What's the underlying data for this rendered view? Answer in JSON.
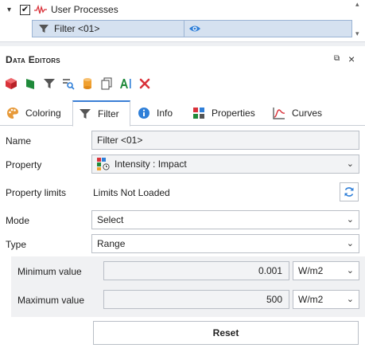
{
  "tree": {
    "process_label": "User Processes",
    "checked_mark": "✔",
    "filter_item_label": "Filter <01>",
    "expander": "▾",
    "scroll_up": "▴",
    "scroll_down": "▾"
  },
  "panel": {
    "title": "Data Editors",
    "float_glyph": "⧉",
    "close_glyph": "×"
  },
  "toolbar": {
    "icons": [
      "cube-red-icon",
      "flag-green-icon",
      "filter-icon",
      "query-icon",
      "cylinder-icon",
      "copy-icon",
      "text-label-icon",
      "delete-icon"
    ]
  },
  "tabs": [
    {
      "label": "Coloring",
      "icon": "palette-icon"
    },
    {
      "label": "Filter",
      "icon": "filter-icon",
      "active": true
    },
    {
      "label": "Info",
      "icon": "info-icon"
    },
    {
      "label": "Properties",
      "icon": "properties-icon"
    },
    {
      "label": "Curves",
      "icon": "curves-icon"
    }
  ],
  "form": {
    "name_label": "Name",
    "name_value": "Filter <01>",
    "property_label": "Property",
    "property_value": "Intensity : Impact",
    "limits_label": "Property limits",
    "limits_value": "Limits Not Loaded",
    "mode_label": "Mode",
    "mode_value": "Select",
    "type_label": "Type",
    "type_value": "Range",
    "min_label": "Minimum value",
    "min_value": "0.001",
    "min_unit": "W/m2",
    "max_label": "Maximum value",
    "max_value": "500",
    "max_unit": "W/m2",
    "reset_label": "Reset",
    "chevron": "⌄"
  },
  "colors": {
    "accent": "#3a7fd5",
    "selection": "#d5e1f0",
    "delete_red": "#d9323a"
  }
}
